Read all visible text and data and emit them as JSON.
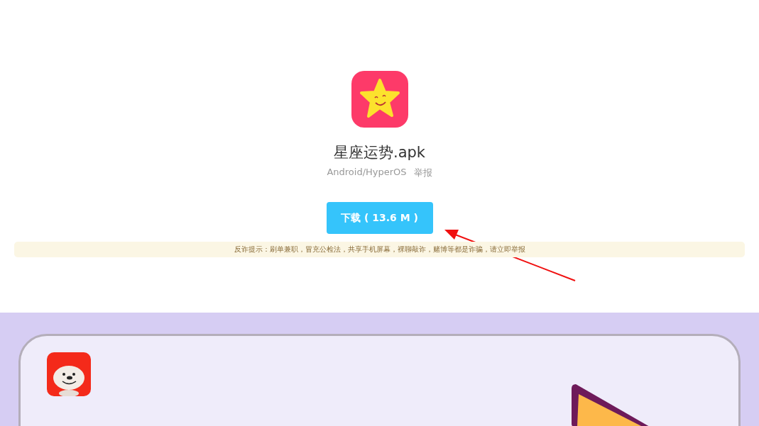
{
  "app": {
    "file_name": "星座运势.apk",
    "platform": "Android/HyperOS",
    "report_link": "举报"
  },
  "download_button": {
    "label": "下载 ( 13.6 M )"
  },
  "notice": {
    "text": "反诈提示：刷单兼职，冒充公检法，共享手机屏幕，裸聊敲诈，赌博等都是诈骗，请立即举报"
  }
}
